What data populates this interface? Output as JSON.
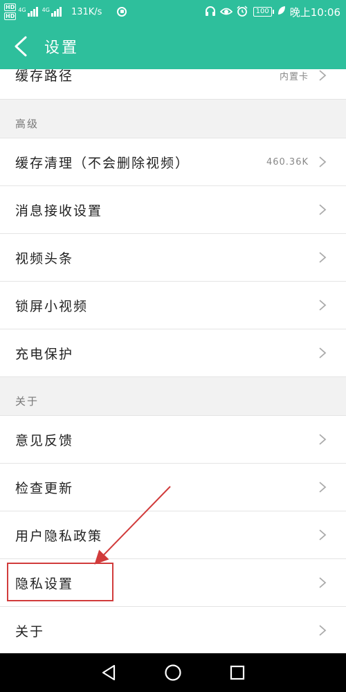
{
  "status_bar": {
    "hd1": "HD",
    "hd2": "HD",
    "net1": "4G",
    "net2": "4G",
    "speed": "131K/s",
    "battery": "100",
    "time": "晚上10:06",
    "icons": [
      "headset-icon",
      "eye-icon",
      "alarm-icon",
      "battery-icon",
      "leaf-icon"
    ]
  },
  "header": {
    "title": "设置",
    "background": "#2ebf9c"
  },
  "settings": {
    "cache_path": {
      "label": "缓存路径",
      "value": "内置卡"
    },
    "section_advanced": "高级",
    "advanced": [
      {
        "label": "缓存清理（不会删除视频）",
        "value": "460.36K"
      },
      {
        "label": "消息接收设置"
      },
      {
        "label": "视频头条"
      },
      {
        "label": "锁屏小视频"
      },
      {
        "label": "充电保护"
      }
    ],
    "section_about": "关于",
    "about": [
      {
        "label": "意见反馈"
      },
      {
        "label": "检查更新"
      },
      {
        "label": "用户隐私政策"
      },
      {
        "label": "隐私设置"
      },
      {
        "label": "关于"
      }
    ]
  },
  "annotation": {
    "color": "#d13b3b",
    "target": "隐私设置"
  }
}
